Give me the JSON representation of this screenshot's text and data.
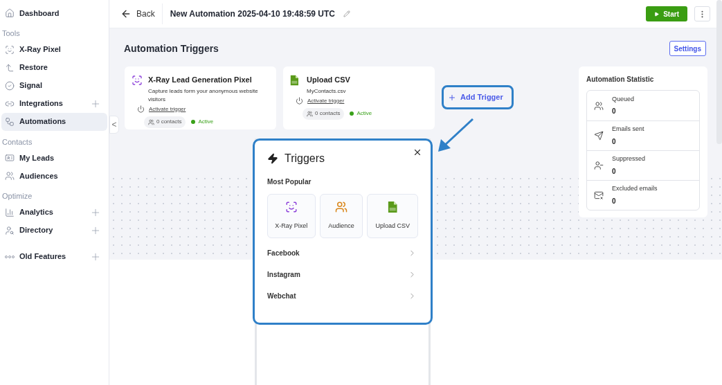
{
  "sidebar": {
    "sections": [
      {
        "items": [
          {
            "kind": "home",
            "label": "Dashboard",
            "selected": false,
            "expandable": false
          }
        ]
      },
      {
        "label": "Tools",
        "items": [
          {
            "kind": "pixel",
            "label": "X-Ray Pixel",
            "selected": false,
            "expandable": false
          },
          {
            "kind": "restore",
            "label": "Restore",
            "selected": false,
            "expandable": false
          },
          {
            "kind": "signal",
            "label": "Signal",
            "selected": false,
            "expandable": false
          },
          {
            "kind": "link",
            "label": "Integrations",
            "selected": false,
            "expandable": true
          },
          {
            "kind": "flow",
            "label": "Automations",
            "selected": true,
            "expandable": false
          }
        ]
      },
      {
        "label": "Contacts",
        "items": [
          {
            "kind": "card",
            "label": "My Leads",
            "selected": false,
            "expandable": false
          },
          {
            "kind": "group",
            "label": "Audiences",
            "selected": false,
            "expandable": false
          }
        ]
      },
      {
        "label": "Optimize",
        "items": [
          {
            "kind": "chart",
            "label": "Analytics",
            "selected": false,
            "expandable": true
          },
          {
            "kind": "person",
            "label": "Directory",
            "selected": false,
            "expandable": true
          }
        ]
      },
      {
        "items": [
          {
            "kind": "dots",
            "label": "Old Features",
            "selected": false,
            "expandable": true
          }
        ]
      }
    ],
    "collapse": "<"
  },
  "header": {
    "back": "Back",
    "title": "New Automation 2025-04-10 19:48:59 UTC",
    "start": "Start"
  },
  "triggers": {
    "title": "Automation Triggers",
    "settings": "Settings",
    "add": "Add Trigger",
    "cards": [
      {
        "kind": "pixel",
        "title": "X-Ray Lead Generation Pixel",
        "description": "Capture leads form your anonymous website visitors",
        "action": "Activate trigger",
        "contacts": "0 contacts",
        "status": "Active"
      },
      {
        "kind": "csv",
        "title": "Upload CSV",
        "description": "MyContacts.csv",
        "action": "Activate trigger",
        "contacts": "0 contacts",
        "status": "Active"
      }
    ]
  },
  "statistic": {
    "title": "Automation Statistic",
    "rows": [
      {
        "kind": "queued",
        "label": "Queued",
        "value": "0"
      },
      {
        "kind": "sent",
        "label": "Emails sent",
        "value": "0"
      },
      {
        "kind": "suppressed",
        "label": "Suppressed",
        "value": "0"
      },
      {
        "kind": "excluded",
        "label": "Excluded emails",
        "value": "0"
      }
    ]
  },
  "popup": {
    "title": "Triggers",
    "section": "Most Popular",
    "popular": [
      {
        "kind": "pixel",
        "label": "X-Ray Pixel"
      },
      {
        "kind": "group",
        "label": "Audience"
      },
      {
        "kind": "csv",
        "label": "Upload CSV"
      }
    ],
    "channels": [
      "Facebook",
      "Instagram",
      "Webchat"
    ]
  }
}
